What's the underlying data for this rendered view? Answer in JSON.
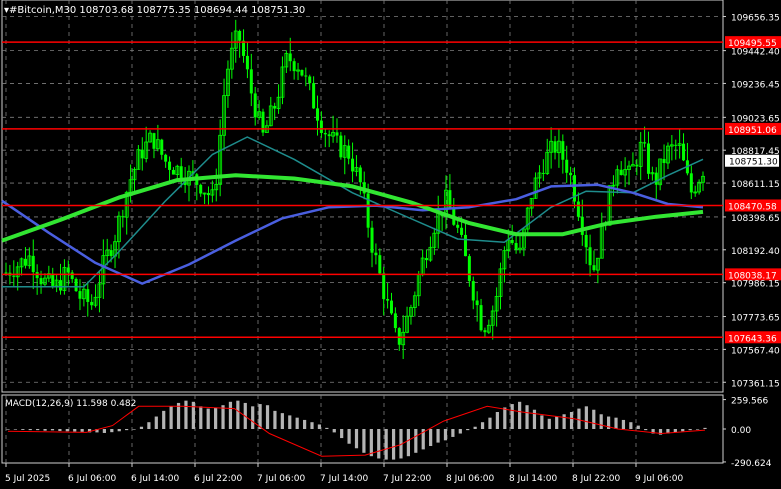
{
  "header": {
    "symbol": "#Bitcoin,M30",
    "ohlc": "108703.68 108775.35 108694.44 108751.30",
    "macd_label": "MACD(12,26,9) 11.598 0.482"
  },
  "colors": {
    "background": "#000000",
    "candle": "#00ff00",
    "grid": "#7f7f7f",
    "axis_text": "#ffffff",
    "hline": "#ff0000",
    "ma_fast": "#1e8c8c",
    "ma_mid": "#4a5fe0",
    "ma_slow": "#32e632",
    "macd_hist": "#b4b4b4",
    "macd_signal": "#ff0000",
    "current_price_box": "#ffffff"
  },
  "chart_data": {
    "type": "candlestick",
    "price_ticks": [
      "109656.35",
      "109442.40",
      "109236.45",
      "109023.65",
      "108817.45",
      "108611.15",
      "108398.65",
      "108192.40",
      "107986.15",
      "107773.65",
      "107567.40",
      "107361.15"
    ],
    "price_range": [
      107300,
      109760
    ],
    "time_ticks": [
      "5 Jul 2025",
      "6 Jul 06:00",
      "6 Jul 14:00",
      "6 Jul 22:00",
      "7 Jul 06:00",
      "7 Jul 14:00",
      "7 Jul 22:00",
      "8 Jul 06:00",
      "8 Jul 14:00",
      "8 Jul 22:00",
      "9 Jul 06:00"
    ],
    "horizontal_levels": [
      {
        "price": 109495.55,
        "label": "109495.55"
      },
      {
        "price": 108951.06,
        "label": "108951.06"
      },
      {
        "price": 108470.58,
        "label": "108470.58"
      },
      {
        "price": 108038.17,
        "label": "108038.17"
      },
      {
        "price": 107643.36,
        "label": "107643.36"
      }
    ],
    "current_price": {
      "price": 108751.3,
      "label": "108751.30"
    },
    "close_path": [
      108050,
      108100,
      108150,
      108000,
      107950,
      108050,
      107900,
      107850,
      108100,
      108300,
      108600,
      108800,
      108900,
      108750,
      108700,
      108650,
      108600,
      108500,
      109300,
      109550,
      109200,
      108900,
      109100,
      109400,
      109350,
      109150,
      108950,
      108850,
      108800,
      108600,
      108200,
      107900,
      107600,
      107800,
      108100,
      108350,
      108500,
      108300,
      108000,
      107700,
      107850,
      108300,
      108150,
      108550,
      108750,
      108850,
      108700,
      108400,
      108050,
      108400,
      108750,
      108650,
      108850,
      108600,
      108800,
      108850,
      108550,
      108700
    ],
    "moving_averages": [
      {
        "name": "",
        "color": "#1e8c8c",
        "width": 1.5,
        "points": [
          [
            0,
            107960
          ],
          [
            14,
            107960
          ],
          [
            20,
            108180
          ],
          [
            28,
            108500
          ],
          [
            36,
            108790
          ],
          [
            42,
            108900
          ],
          [
            50,
            108760
          ],
          [
            60,
            108550
          ],
          [
            68,
            108420
          ],
          [
            78,
            108260
          ],
          [
            86,
            108240
          ],
          [
            94,
            108460
          ],
          [
            100,
            108560
          ],
          [
            108,
            108550
          ],
          [
            114,
            108660
          ],
          [
            120,
            108760
          ]
        ]
      },
      {
        "name": "",
        "color": "#4a5fe0",
        "width": 2.5,
        "points": [
          [
            0,
            108500
          ],
          [
            8,
            108300
          ],
          [
            16,
            108110
          ],
          [
            24,
            107980
          ],
          [
            32,
            108100
          ],
          [
            40,
            108250
          ],
          [
            48,
            108390
          ],
          [
            56,
            108460
          ],
          [
            64,
            108470
          ],
          [
            72,
            108440
          ],
          [
            80,
            108460
          ],
          [
            88,
            108510
          ],
          [
            94,
            108590
          ],
          [
            102,
            108600
          ],
          [
            108,
            108550
          ],
          [
            114,
            108480
          ],
          [
            120,
            108460
          ]
        ]
      },
      {
        "name": "",
        "color": "#32e632",
        "width": 4,
        "points": [
          [
            0,
            108250
          ],
          [
            10,
            108380
          ],
          [
            20,
            108520
          ],
          [
            30,
            108630
          ],
          [
            40,
            108660
          ],
          [
            50,
            108640
          ],
          [
            60,
            108590
          ],
          [
            70,
            108490
          ],
          [
            80,
            108360
          ],
          [
            88,
            108290
          ],
          [
            96,
            108290
          ],
          [
            104,
            108360
          ],
          [
            112,
            108400
          ],
          [
            120,
            108430
          ]
        ]
      }
    ],
    "macd": {
      "ticks": [
        "259.566",
        "0.00",
        "-290.624"
      ],
      "range": [
        -300,
        300
      ],
      "histogram": [
        -5,
        -5,
        -8,
        -10,
        -10,
        -15,
        -12,
        -18,
        -20,
        -22,
        -25,
        -30,
        -30,
        -35,
        -28,
        -20,
        -10,
        0,
        20,
        60,
        110,
        160,
        200,
        230,
        250,
        240,
        200,
        180,
        190,
        210,
        240,
        250,
        230,
        200,
        220,
        210,
        160,
        140,
        120,
        100,
        80,
        60,
        40,
        10,
        -30,
        -80,
        -130,
        -170,
        -210,
        -240,
        -260,
        -270,
        -270,
        -260,
        -240,
        -210,
        -180,
        -150,
        -120,
        -100,
        -70,
        -40,
        -10,
        20,
        60,
        100,
        150,
        190,
        220,
        240,
        210,
        170,
        120,
        90,
        110,
        130,
        150,
        180,
        200,
        170,
        130,
        110,
        100,
        80,
        60,
        30,
        -10,
        -40,
        -50,
        -40,
        -30,
        -20,
        -10,
        0,
        10
      ],
      "signal": [
        [
          0,
          -20
        ],
        [
          18,
          -30
        ],
        [
          24,
          30
        ],
        [
          30,
          200
        ],
        [
          40,
          200
        ],
        [
          52,
          180
        ],
        [
          60,
          -40
        ],
        [
          72,
          -240
        ],
        [
          82,
          -230
        ],
        [
          90,
          -140
        ],
        [
          100,
          70
        ],
        [
          110,
          200
        ],
        [
          118,
          150
        ],
        [
          130,
          90
        ],
        [
          140,
          0
        ],
        [
          150,
          -40
        ],
        [
          160,
          -10
        ]
      ]
    }
  }
}
